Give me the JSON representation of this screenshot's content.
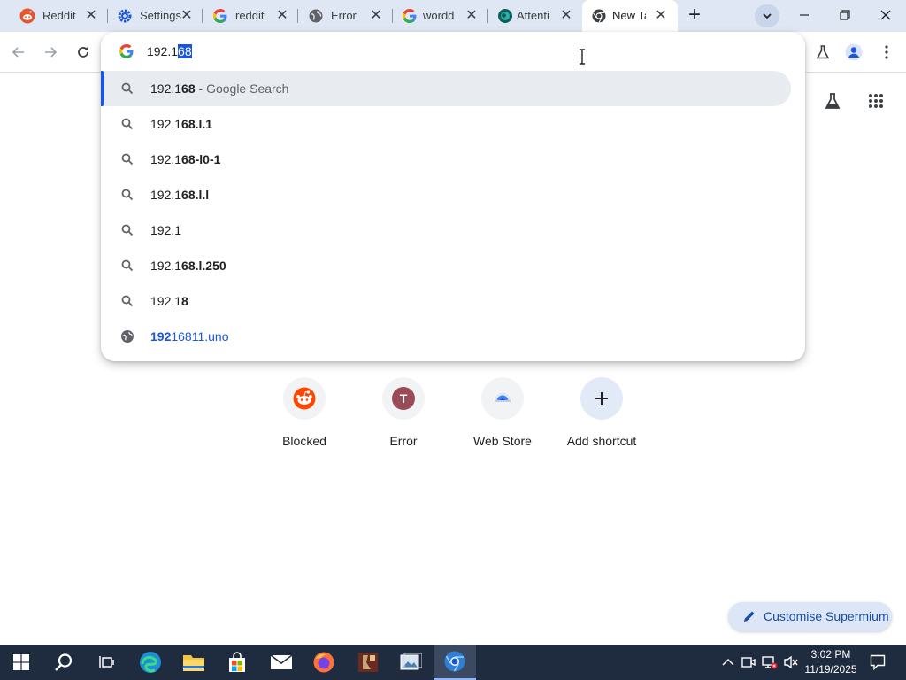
{
  "tabs": [
    {
      "title": "Reddit",
      "icon": "reddit-icon",
      "active": false
    },
    {
      "title": "Settings",
      "icon": "settings-icon",
      "active": false
    },
    {
      "title": "reddit",
      "icon": "google-icon",
      "active": false
    },
    {
      "title": "Error",
      "icon": "globe-icon",
      "active": false
    },
    {
      "title": "wordd",
      "icon": "google-icon",
      "active": false
    },
    {
      "title": "Attenti",
      "icon": "attention-icon",
      "active": false
    },
    {
      "title": "New Ta",
      "icon": "chrome-icon",
      "active": true
    }
  ],
  "omnibox": {
    "typed": "192.1",
    "autocomplete_selected": "68"
  },
  "suggestions": [
    {
      "prefix": "192.1",
      "bold": "68",
      "suffix": " - Google Search",
      "icon": "search-icon",
      "selected": true
    },
    {
      "prefix": "192.1",
      "bold": "68.l.1",
      "suffix": "",
      "icon": "search-icon",
      "selected": false
    },
    {
      "prefix": "192.1",
      "bold": "68-l0-1",
      "suffix": "",
      "icon": "search-icon",
      "selected": false
    },
    {
      "prefix": "192.1",
      "bold": "68.l.l",
      "suffix": "",
      "icon": "search-icon",
      "selected": false
    },
    {
      "prefix": "192.1",
      "bold": "",
      "suffix": "",
      "icon": "search-icon",
      "selected": false
    },
    {
      "prefix": "192.1",
      "bold": "68.l.250",
      "suffix": "",
      "icon": "search-icon",
      "selected": false
    },
    {
      "prefix": "192.1",
      "bold": "8",
      "suffix": "",
      "icon": "search-icon",
      "selected": false
    },
    {
      "url_bold": "192",
      "url_rest": "16811.uno",
      "icon": "globe-icon",
      "selected": false
    }
  ],
  "shortcuts": [
    {
      "label": "Blocked",
      "icon": "reddit-icon"
    },
    {
      "label": "Error",
      "letter": "T",
      "icon": "letter-avatar-icon"
    },
    {
      "label": "Web Store",
      "icon": "web-store-icon"
    },
    {
      "label": "Add shortcut",
      "icon": "plus-icon"
    }
  ],
  "customise_label": "Customise Supermium",
  "clock": {
    "time": "3:02 PM",
    "date": "11/19/2025"
  },
  "colors": {
    "accent": "#1a56d6",
    "tabstrip": "#dfe7f5",
    "taskbar": "#1f2b3e"
  }
}
